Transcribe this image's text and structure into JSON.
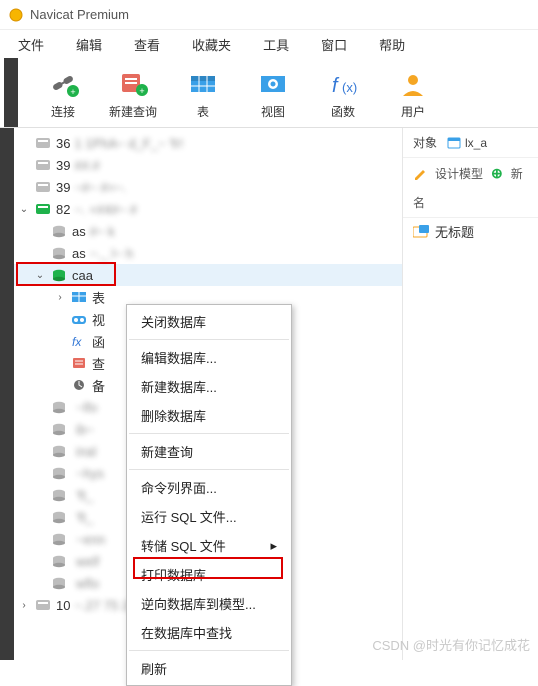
{
  "title": "Navicat Premium",
  "menus": [
    "文件",
    "编辑",
    "查看",
    "收藏夹",
    "工具",
    "窗口",
    "帮助"
  ],
  "toolbar": [
    {
      "id": "connect",
      "label": "连接"
    },
    {
      "id": "newquery",
      "label": "新建查询"
    },
    {
      "id": "table",
      "label": "表"
    },
    {
      "id": "view",
      "label": "视图"
    },
    {
      "id": "function",
      "label": "函数"
    },
    {
      "id": "user",
      "label": "用户"
    }
  ],
  "tree": {
    "items": [
      {
        "depth": 0,
        "icon": "conn-gray",
        "label": "36",
        "blur": "1 1PhA~ d_F_~ 'fr!"
      },
      {
        "depth": 0,
        "icon": "conn-gray",
        "label": "39",
        "blur": "##.#"
      },
      {
        "depth": 0,
        "icon": "conn-gray",
        "label": "39",
        "blur": "~#~ #=~."
      },
      {
        "depth": 0,
        "icon": "conn-green",
        "label": "82",
        "blur": "~.  +#4#~ #",
        "exp": "open"
      },
      {
        "depth": 1,
        "icon": "db-gray",
        "label": "as",
        "blur": "#~ k"
      },
      {
        "depth": 1,
        "icon": "db-gray",
        "label": "as",
        "blur": "~._  l~ h"
      },
      {
        "depth": 1,
        "icon": "db-green",
        "label": "caa",
        "blur": "",
        "exp": "open",
        "sel": true,
        "mark": true
      },
      {
        "depth": 2,
        "icon": "tbl",
        "label": "表",
        "blur": "",
        "exp": "closed"
      },
      {
        "depth": 2,
        "icon": "view",
        "label": "视",
        "blur": ""
      },
      {
        "depth": 2,
        "icon": "fx",
        "label": "函",
        "blur": ""
      },
      {
        "depth": 2,
        "icon": "qry",
        "label": "查",
        "blur": ""
      },
      {
        "depth": 2,
        "icon": "bak",
        "label": "备",
        "blur": ""
      },
      {
        "depth": 1,
        "icon": "db-gray",
        "label": "",
        "blur": "~lfo"
      },
      {
        "depth": 1,
        "icon": "db-gray",
        "label": "",
        "blur": "ib~"
      },
      {
        "depth": 1,
        "icon": "db-gray",
        "label": "",
        "blur": "inal"
      },
      {
        "depth": 1,
        "icon": "db-gray",
        "label": "",
        "blur": "~hys"
      },
      {
        "depth": 1,
        "icon": "db-gray",
        "label": "",
        "blur": "'ft_"
      },
      {
        "depth": 1,
        "icon": "db-gray",
        "label": "",
        "blur": "'ft_"
      },
      {
        "depth": 1,
        "icon": "db-gray",
        "label": "",
        "blur": "~enn"
      },
      {
        "depth": 1,
        "icon": "db-gray",
        "label": "",
        "blur": "welf"
      },
      {
        "depth": 1,
        "icon": "db-gray",
        "label": "",
        "blur": "wflo"
      },
      {
        "depth": 0,
        "icon": "conn-gray",
        "label": "10",
        "blur": "~.27 75 241  ~~~l~~~",
        "exp": "closed"
      }
    ]
  },
  "context": {
    "items": [
      {
        "label": "关闭数据库"
      },
      {
        "sep": true
      },
      {
        "label": "编辑数据库..."
      },
      {
        "label": "新建数据库..."
      },
      {
        "label": "删除数据库"
      },
      {
        "sep": true
      },
      {
        "label": "新建查询"
      },
      {
        "sep": true
      },
      {
        "label": "命令列界面..."
      },
      {
        "label": "运行 SQL 文件..."
      },
      {
        "label": "转储 SQL 文件",
        "sub": true
      },
      {
        "label": "打印数据库"
      },
      {
        "label": "逆向数据库到模型...",
        "mark": true
      },
      {
        "label": "在数据库中查找"
      },
      {
        "sep": true
      },
      {
        "label": "刷新"
      }
    ]
  },
  "right": {
    "tabs": [
      {
        "label": "对象"
      },
      {
        "label": "lx_a",
        "icon": "model"
      }
    ],
    "design": "设计模型",
    "new": "新",
    "header": "名",
    "item": "无标题"
  },
  "watermark": "CSDN @时光有你记忆成花"
}
